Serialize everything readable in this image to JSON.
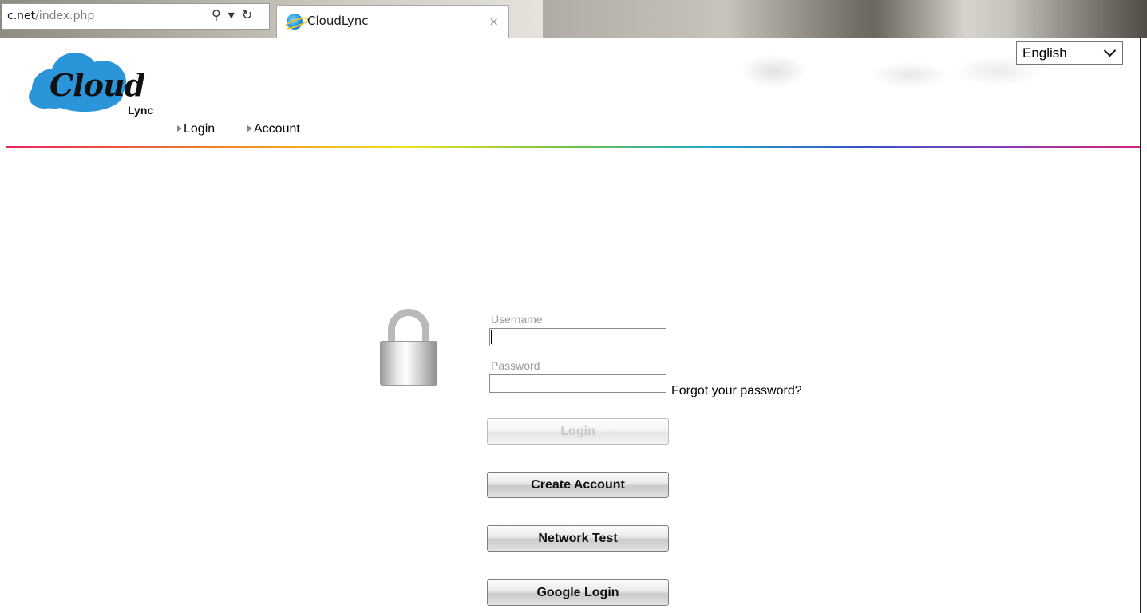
{
  "browser": {
    "address_host": "c.net",
    "address_path": "/index.php",
    "tab_title": "CloudLync",
    "tab_close": "×",
    "tools": "⚲ ▾ ↻"
  },
  "header": {
    "logo_word": "Cloud",
    "logo_sub": "Lync",
    "nav": [
      {
        "label": "Login"
      },
      {
        "label": "Account"
      }
    ],
    "language": "English"
  },
  "login_form": {
    "username_label": "Username",
    "username_value": "",
    "password_label": "Password",
    "password_value": "",
    "forgot_link": "Forgot your password?",
    "buttons": {
      "login": "Login",
      "create_account": "Create Account",
      "network_test": "Network Test",
      "google_login": "Google Login"
    }
  },
  "colors": {
    "logo_cloud": "#2b95d9",
    "rainbow": [
      "#e8235d",
      "#f08a24",
      "#f4e01c",
      "#6cc24a",
      "#21a8c9",
      "#3457c4",
      "#8b3ab8",
      "#d4247a"
    ]
  }
}
